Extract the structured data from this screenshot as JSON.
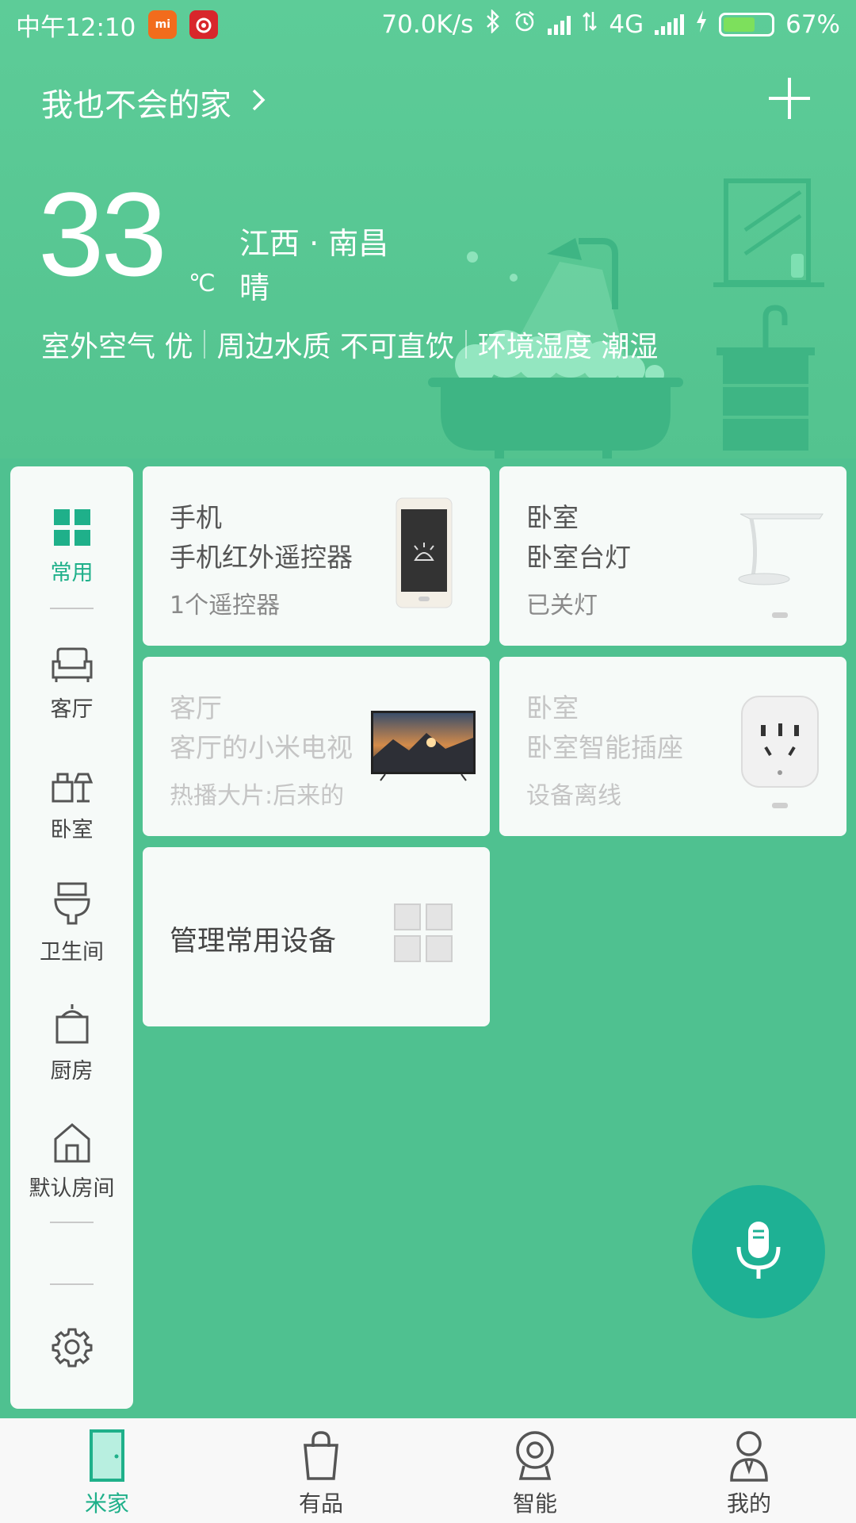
{
  "status_bar": {
    "time": "中午12:10",
    "net_speed": "70.0K/s",
    "network": "4G",
    "battery": "67%",
    "battery_level": 0.67,
    "badge_mi": "mi"
  },
  "header": {
    "home_name": "我也不会的家"
  },
  "weather": {
    "temperature": "33",
    "unit": "℃",
    "location": "江西 · 南昌",
    "condition": "晴",
    "env": [
      "室外空气 优",
      "周边水质 不可直饮",
      "环境湿度 潮湿"
    ]
  },
  "rooms": [
    {
      "label": "常用",
      "icon": "grid-icon",
      "active": true
    },
    {
      "label": "客厅",
      "icon": "sofa-icon",
      "active": false
    },
    {
      "label": "卧室",
      "icon": "bedroom-lamp-icon",
      "active": false
    },
    {
      "label": "卫生间",
      "icon": "toilet-icon",
      "active": false
    },
    {
      "label": "厨房",
      "icon": "pot-icon",
      "active": false
    },
    {
      "label": "默认房间",
      "icon": "house-icon",
      "active": false
    }
  ],
  "devices": [
    {
      "room": "手机",
      "name": "手机红外遥控器",
      "status": "1个遥控器",
      "icon": "phone-icon",
      "offline": false
    },
    {
      "room": "卧室",
      "name": "卧室台灯",
      "status": "已关灯",
      "icon": "desk-lamp-icon",
      "offline": false
    },
    {
      "room": "客厅",
      "name": "客厅的小米电视",
      "status": "热播大片:后来的",
      "icon": "tv-icon",
      "offline": true
    },
    {
      "room": "卧室",
      "name": "卧室智能插座",
      "status": "设备离线",
      "icon": "smart-plug-icon",
      "offline": true
    }
  ],
  "manage": {
    "label": "管理常用设备"
  },
  "tabs": [
    {
      "label": "米家",
      "icon": "door-icon",
      "active": true
    },
    {
      "label": "有品",
      "icon": "bag-icon",
      "active": false
    },
    {
      "label": "智能",
      "icon": "camera-icon",
      "active": false
    },
    {
      "label": "我的",
      "icon": "person-icon",
      "active": false
    }
  ],
  "colors": {
    "background": "#4fc190",
    "accent": "#1fb08a",
    "mic_button": "#1eb194"
  }
}
